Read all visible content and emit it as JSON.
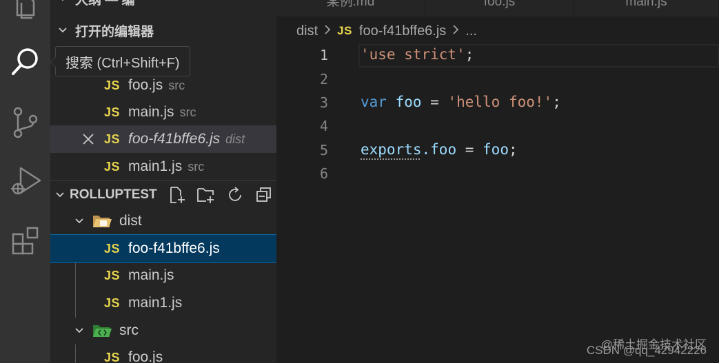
{
  "tooltip": {
    "text": "搜索 (Ctrl+Shift+F)"
  },
  "tabs": [
    "某例.md",
    "foo.js",
    "main.js"
  ],
  "open_editors": {
    "cutoff_label": "大纲 — 编",
    "header": "打开的编辑器",
    "items": [
      {
        "badge": "JS",
        "name": "foo.js",
        "desc": "src"
      },
      {
        "badge": "JS",
        "name": "main.js",
        "desc": "src"
      },
      {
        "badge": "JS",
        "name": "foo-f41bffe6.js",
        "desc": "dist",
        "active": true
      },
      {
        "badge": "JS",
        "name": "main1.js",
        "desc": "src"
      }
    ]
  },
  "explorer": {
    "header": "ROLLUPTEST",
    "folders": [
      {
        "name": "dist",
        "files": [
          "foo-f41bffe6.js",
          "main.js",
          "main1.js"
        ]
      },
      {
        "name": "src",
        "files": [
          "foo.js"
        ]
      }
    ],
    "badge": "JS"
  },
  "breadcrumb": {
    "folder": "dist",
    "badge": "JS",
    "file": "foo-f41bffe6.js",
    "more": "..."
  },
  "editor": {
    "line_numbers": [
      "1",
      "2",
      "3",
      "4",
      "5",
      "6"
    ],
    "lines": {
      "l1": {
        "str": "'use strict'",
        "punct": ";"
      },
      "l3": {
        "kw": "var",
        "var": "foo",
        "op": " = ",
        "str": "'hello foo!'",
        "punct": ";"
      },
      "l5": {
        "obj": "exports",
        "prop": ".foo",
        "op": " = ",
        "var": "foo",
        "punct": ";"
      }
    }
  },
  "watermark": {
    "line1": "@稀土掘金技术社区",
    "line2": "CSDN @qq_42942226"
  },
  "colors": {
    "accent_selection": "#04395e",
    "js_yellow": "#e8d44d",
    "string": "#ce9178",
    "keyword": "#569cd6",
    "variable": "#9cdcfe"
  }
}
